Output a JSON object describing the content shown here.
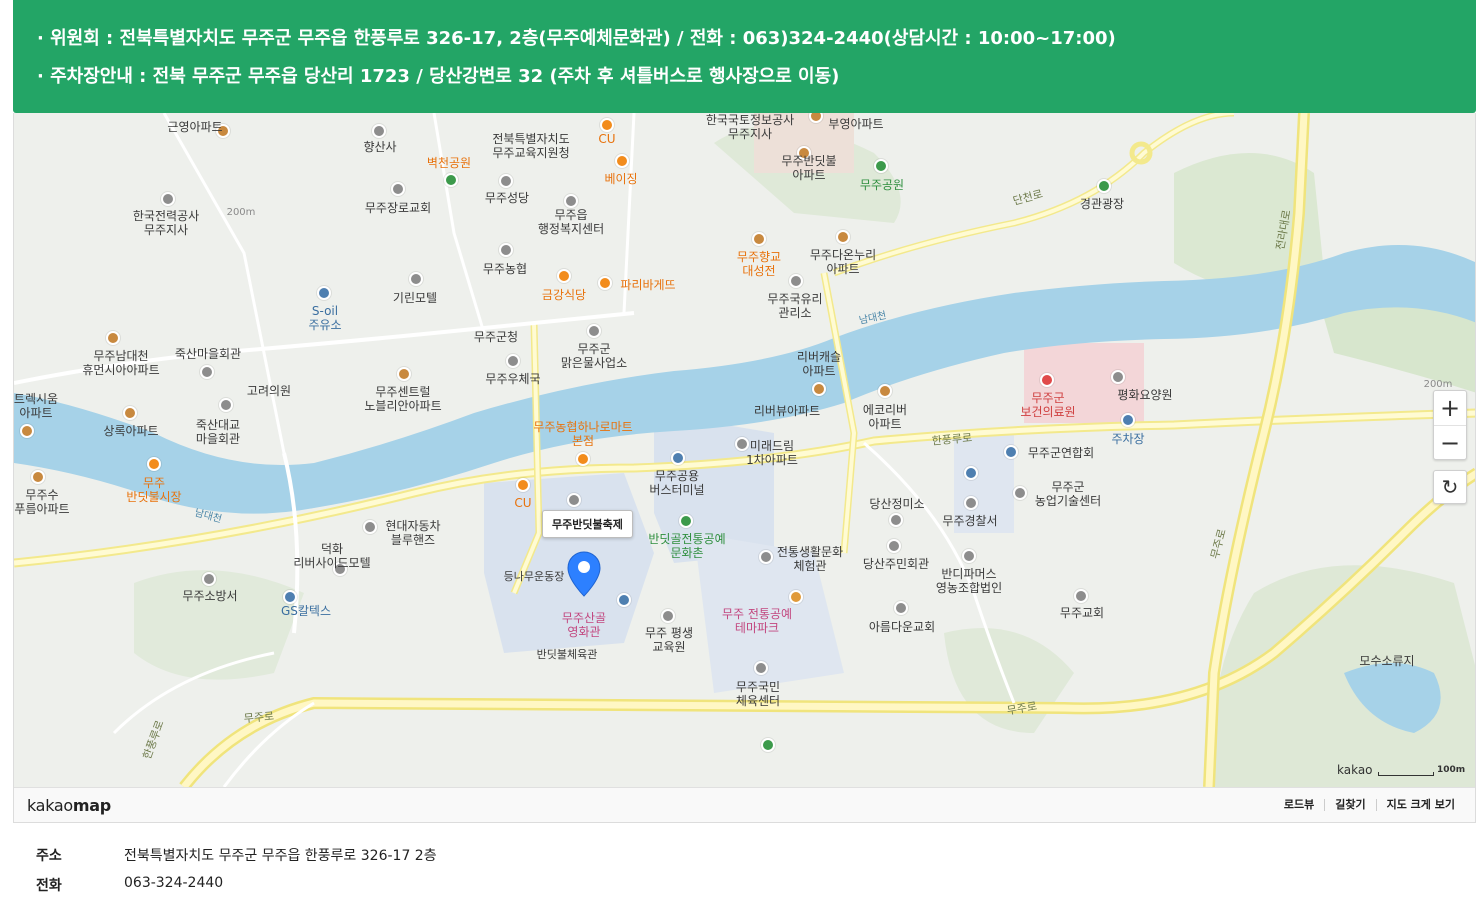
{
  "banner": {
    "line1": "· 위원회 : 전북특별자치도 무주군 무주읍 한풍루로 326-17, 2층(무주예체문화관) / 전화 : 063)324-2440(상담시간 : 10:00~17:00)",
    "line2": "· 주차장안내 : 전북 무주군 무주읍 당산리 1723 / 당산강변로 32 (주차 후 셔틀버스로 행사장으로 이동)",
    "color": "#23a566"
  },
  "map": {
    "marker_label": "무주반딧불축제",
    "zoom_in_label": "+",
    "zoom_out_label": "−",
    "refresh_icon": "refresh-icon",
    "scale_brand": "kakao",
    "scale_text": "100m",
    "labels": {
      "geunyeong": "근영아파트",
      "hyangsan": "향산사",
      "jeonbuk_edu": "전북특별자치도\n무주교육지원청",
      "cu_top": "CU",
      "lx": "한국국토정보공사\n무주지사",
      "buyeong": "부영아파트",
      "bandit_apt": "무주반딧불\n아파트",
      "muju_park": "무주공원",
      "byeokcheon": "벽천공원",
      "beijing": "베이징",
      "kepco": "한국전력공사\n무주지사",
      "church1": "무주장로교회",
      "seongdang": "무주성당",
      "eup_office": "무주읍\n행정복지센터",
      "dancheon_ro": "단천로",
      "gyeonggwan": "경관광장",
      "hyanggyo": "무주향교\n대성전",
      "daon": "무주다온누리\n아파트",
      "nonghyup": "무주농협",
      "geumgang": "금강식당",
      "paris": "파리바게뜨",
      "kirin": "기린모텔",
      "soil": "S-oil\n주유소",
      "guncheong": "무주군청",
      "yuri": "무주국유리\n관리소",
      "namdaecheon1": "남대천",
      "namdaecheon_apt": "무주남대천\n휴먼시아아파트",
      "juksan_hall": "죽산마을회관",
      "goryeo": "고려의원",
      "central": "무주센트럴\n노블리안아파트",
      "post": "무주우체국",
      "water": "무주군\n맑은물사업소",
      "castle": "리버캐슬\n아파트",
      "medical": "무주군\n보건의료원",
      "pyeonghwa": "평화요양원",
      "parking": "주차장",
      "trexium": "트렉시움\n아파트",
      "sangnok": "상록아파트",
      "juksan_bridge": "죽산대교\n마을회관",
      "hanaro": "무주농협하나로마트\n본점",
      "riverview": "리버뷰아파트",
      "eco": "에코리버\n아파트",
      "miracle": "미래드림\n1차아파트",
      "hanpung": "한풍루로",
      "association": "무주군연합회",
      "bandit_market": "무주\n반딧불시장",
      "musu": "무주수\n푸름아파트",
      "namdaecheon2": "남대천",
      "cu_bottom": "CU",
      "terminal": "무주공용\n버스터미널",
      "dangsan_school": "당산정미소",
      "police": "무주경찰서",
      "agri": "무주군\n농업기술센터",
      "hyundai": "현대자동차\n블루핸즈",
      "deokhwa": "덕화\n리버사이드모텔",
      "craft": "반딧골전통공예\n문화촌",
      "tradition": "전통생활문화\n체험관",
      "dangsan_hall": "당산주민회관",
      "bandi_farm": "반디파머스\n영농조합법인",
      "donga": "등나무운동장",
      "cinema": "무주산골\n영화관",
      "fire": "무주소방서",
      "gs": "GS칼텍스",
      "theme": "무주 전통공예\n테마파크",
      "lifelong": "무주 평생\n교육원",
      "areum": "아름다운교회",
      "muju_church": "무주교회",
      "gym_bandit": "반딧불체육관",
      "sports": "무주국민\n체육센터",
      "mosu": "모수소류지",
      "muju_ro1": "무주로",
      "muju_ro2": "무주로",
      "hanpung2": "한풍루로",
      "muju_ro_v": "무주로",
      "jeolla": "전라대로",
      "alt200a": "200m",
      "alt200b": "200m"
    }
  },
  "footer": {
    "logo_light": "kakao",
    "logo_bold": "map",
    "links": [
      "로드뷰",
      "길찾기",
      "지도 크게 보기"
    ]
  },
  "details": {
    "address_key": "주소",
    "address_value": "전북특별자치도 무주군 무주읍 한풍루로 326-17 2층",
    "phone_key": "전화",
    "phone_value": "063-324-2440"
  }
}
